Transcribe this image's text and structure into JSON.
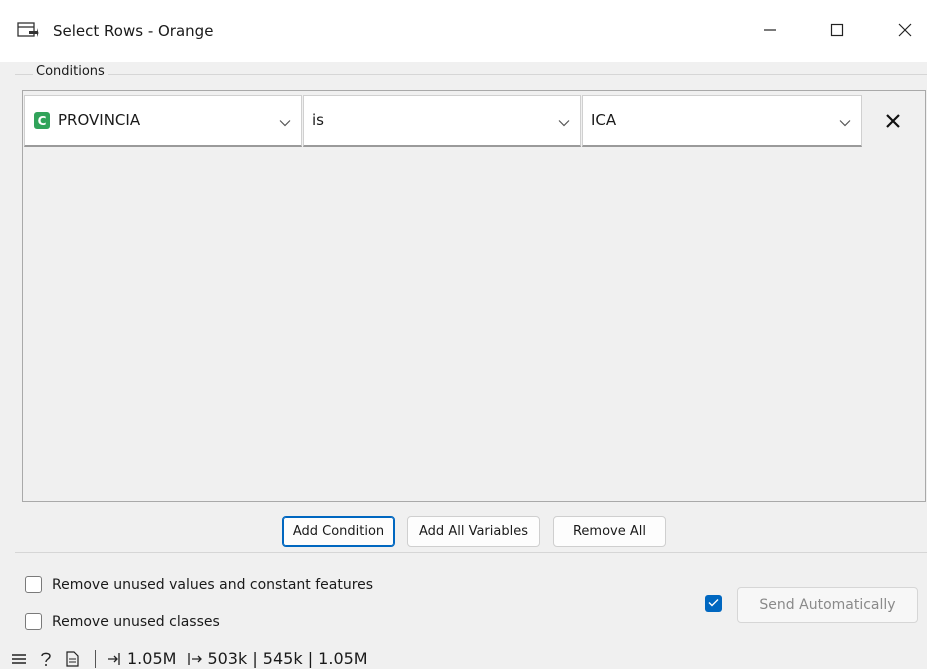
{
  "window": {
    "title": "Select Rows - Orange",
    "icons": {
      "app": "table-filter-icon",
      "minimize": "minimize-icon",
      "maximize": "maximize-icon",
      "close": "close-icon"
    }
  },
  "conditions": {
    "group_label": "Conditions",
    "rows": [
      {
        "variable_type_badge": "C",
        "variable": "PROVINCIA",
        "operator": "is",
        "value": "ICA"
      }
    ]
  },
  "buttons": {
    "add_condition": "Add Condition",
    "add_all_variables": "Add All Variables",
    "remove_all": "Remove All"
  },
  "options": {
    "remove_unused_values": {
      "label": "Remove unused values and constant features",
      "checked": false
    },
    "remove_unused_classes": {
      "label": "Remove unused classes",
      "checked": false
    }
  },
  "send": {
    "auto_checked": true,
    "label": "Send Automatically"
  },
  "status": {
    "input_size": "1.05M",
    "output_sizes": "503k | 545k | 1.05M"
  },
  "colors": {
    "accent": "#0067c0",
    "continuous_badge": "#31a35a"
  }
}
